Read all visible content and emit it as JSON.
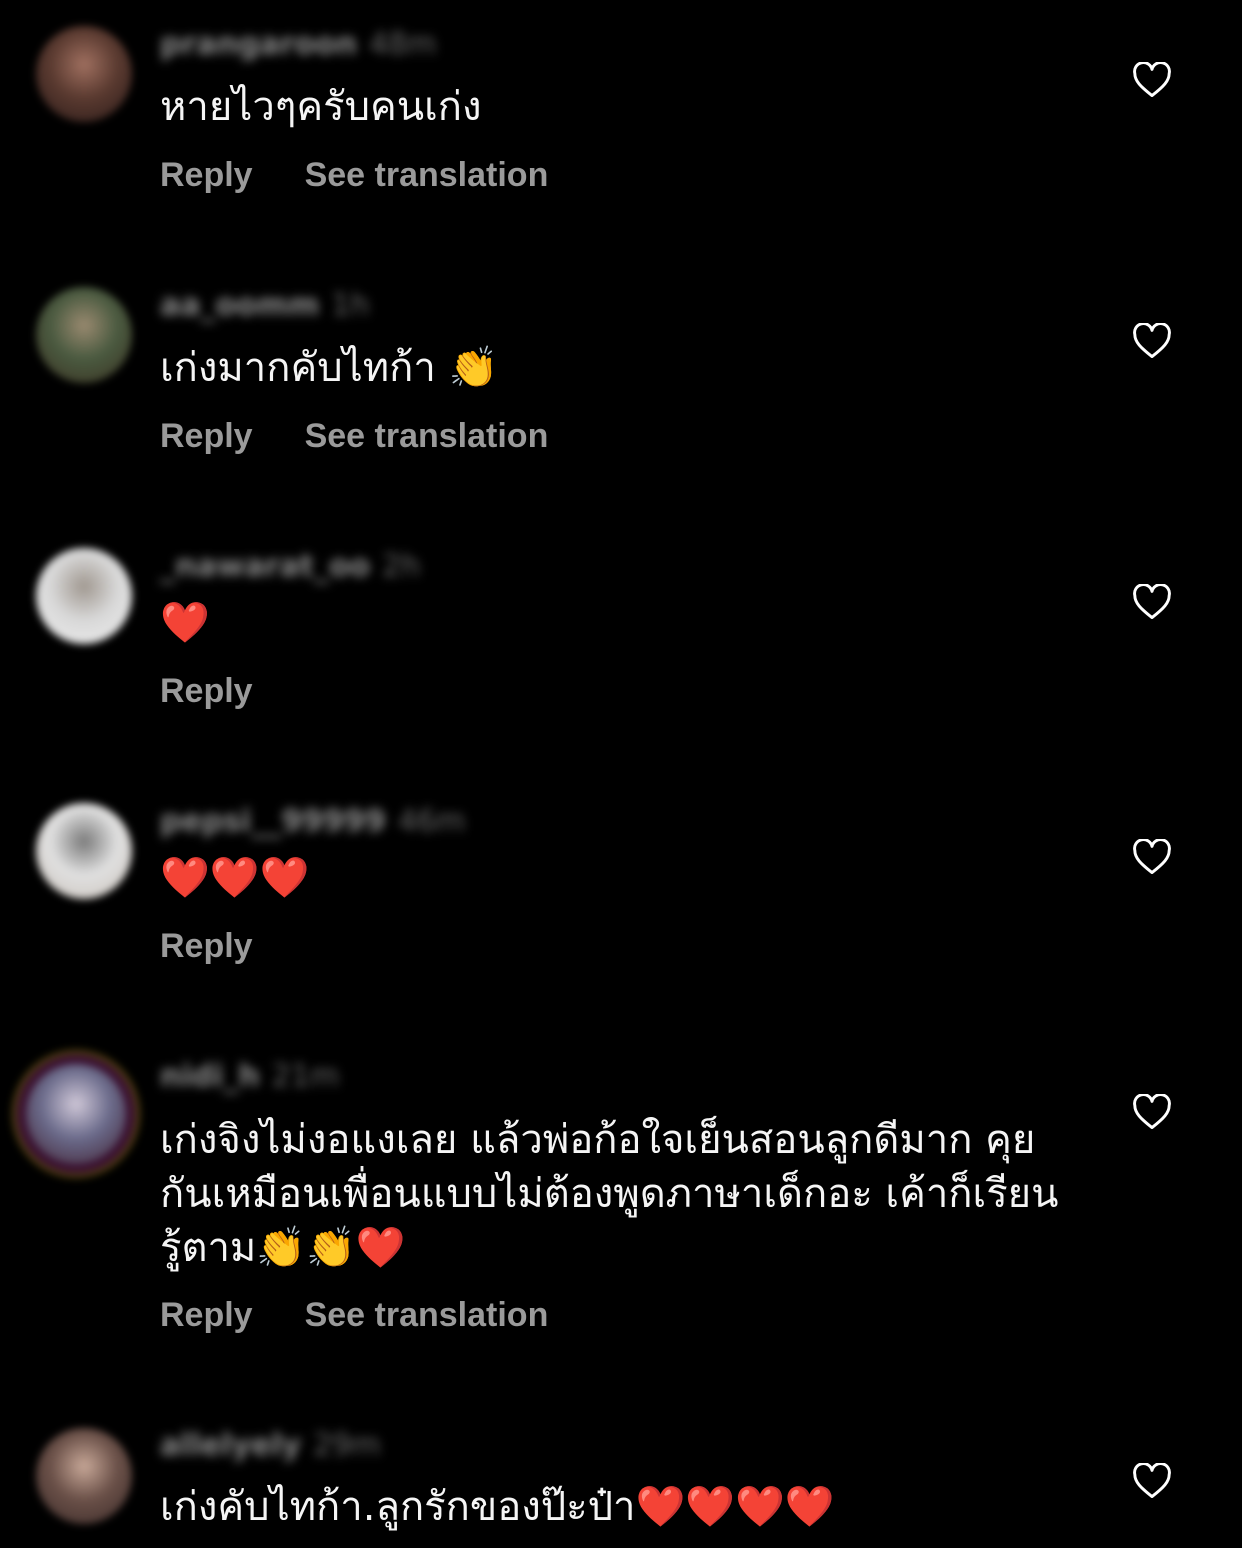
{
  "colors": {
    "background": "#000000",
    "text": "#f5f5f5",
    "secondary": "#9a9a9a"
  },
  "comments": [
    {
      "username": "prangaroon",
      "time": "48m",
      "text": "หายไวๆครับคนเก่ง",
      "reply_label": "Reply",
      "translate_label": "See translation",
      "avatar_colors": [
        "#5a3a30",
        "#a07060",
        "#2a1a18"
      ]
    },
    {
      "username": "aa_oomm",
      "time": "1h",
      "text": "เก่งมากคับไทก้า 👏",
      "reply_label": "Reply",
      "translate_label": "See translation",
      "avatar_colors": [
        "#4a5a40",
        "#9a8a70",
        "#3a3020"
      ]
    },
    {
      "username": "_nawarat_oo",
      "time": "2h",
      "text": "❤️",
      "reply_label": "Reply",
      "avatar_colors": [
        "#d8d8d8",
        "#a09890",
        "#f0f0f0"
      ]
    },
    {
      "username": "pepsi__99999",
      "time": "46m",
      "text": "❤️❤️❤️",
      "reply_label": "Reply",
      "avatar_colors": [
        "#e0e0e0",
        "#7a7a7a",
        "#c8c0b8"
      ]
    },
    {
      "username": "nidi_h",
      "time": "21m",
      "text": "เก่งจิงไม่งอแงเลย แล้วพ่อก้อใจเย็นสอนลูกดีมาก คุยกันเหมือนเพื่อนแบบไม่ต้องพูดภาษาเด็กอะ เค้าก็เรียนรู้ตาม👏👏❤️",
      "reply_label": "Reply",
      "translate_label": "See translation",
      "avatar_colors": [
        "#6a6a8a",
        "#d0c8d8",
        "#402030"
      ]
    },
    {
      "username": "allelyely",
      "time": "29m",
      "text": "เก่งคับไทก้า.ลูกรักของป๊ะป๋า❤️❤️❤️❤️",
      "avatar_colors": [
        "#6a5048",
        "#c8a898",
        "#3a2a28"
      ]
    }
  ]
}
